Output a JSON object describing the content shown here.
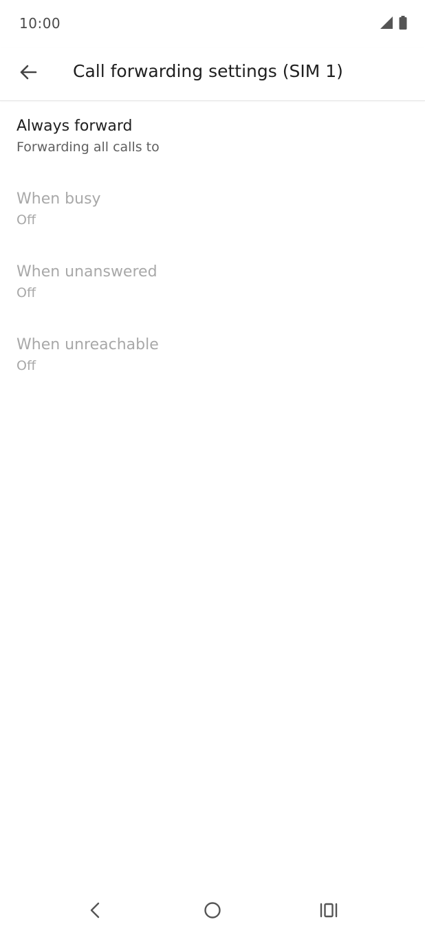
{
  "status_bar": {
    "time": "10:00",
    "icons": [
      "signal-icon",
      "battery-icon"
    ]
  },
  "app_bar": {
    "back_icon": "arrow-back-icon",
    "title": "Call forwarding settings (SIM 1)"
  },
  "settings": {
    "items": [
      {
        "title": "Always forward",
        "summary": "Forwarding all calls to",
        "enabled": true
      },
      {
        "title": "When busy",
        "summary": "Off",
        "enabled": false
      },
      {
        "title": "When unanswered",
        "summary": "Off",
        "enabled": false
      },
      {
        "title": "When unreachable",
        "summary": "Off",
        "enabled": false
      }
    ]
  },
  "nav_bar": {
    "icons": [
      "nav-back-icon",
      "nav-home-icon",
      "nav-recents-icon"
    ]
  },
  "colors": {
    "background": "#ffffff",
    "text_primary": "#1f1f1f",
    "text_secondary": "#5f5f5f",
    "text_disabled": "#a8a8a8",
    "icon": "#555555"
  }
}
